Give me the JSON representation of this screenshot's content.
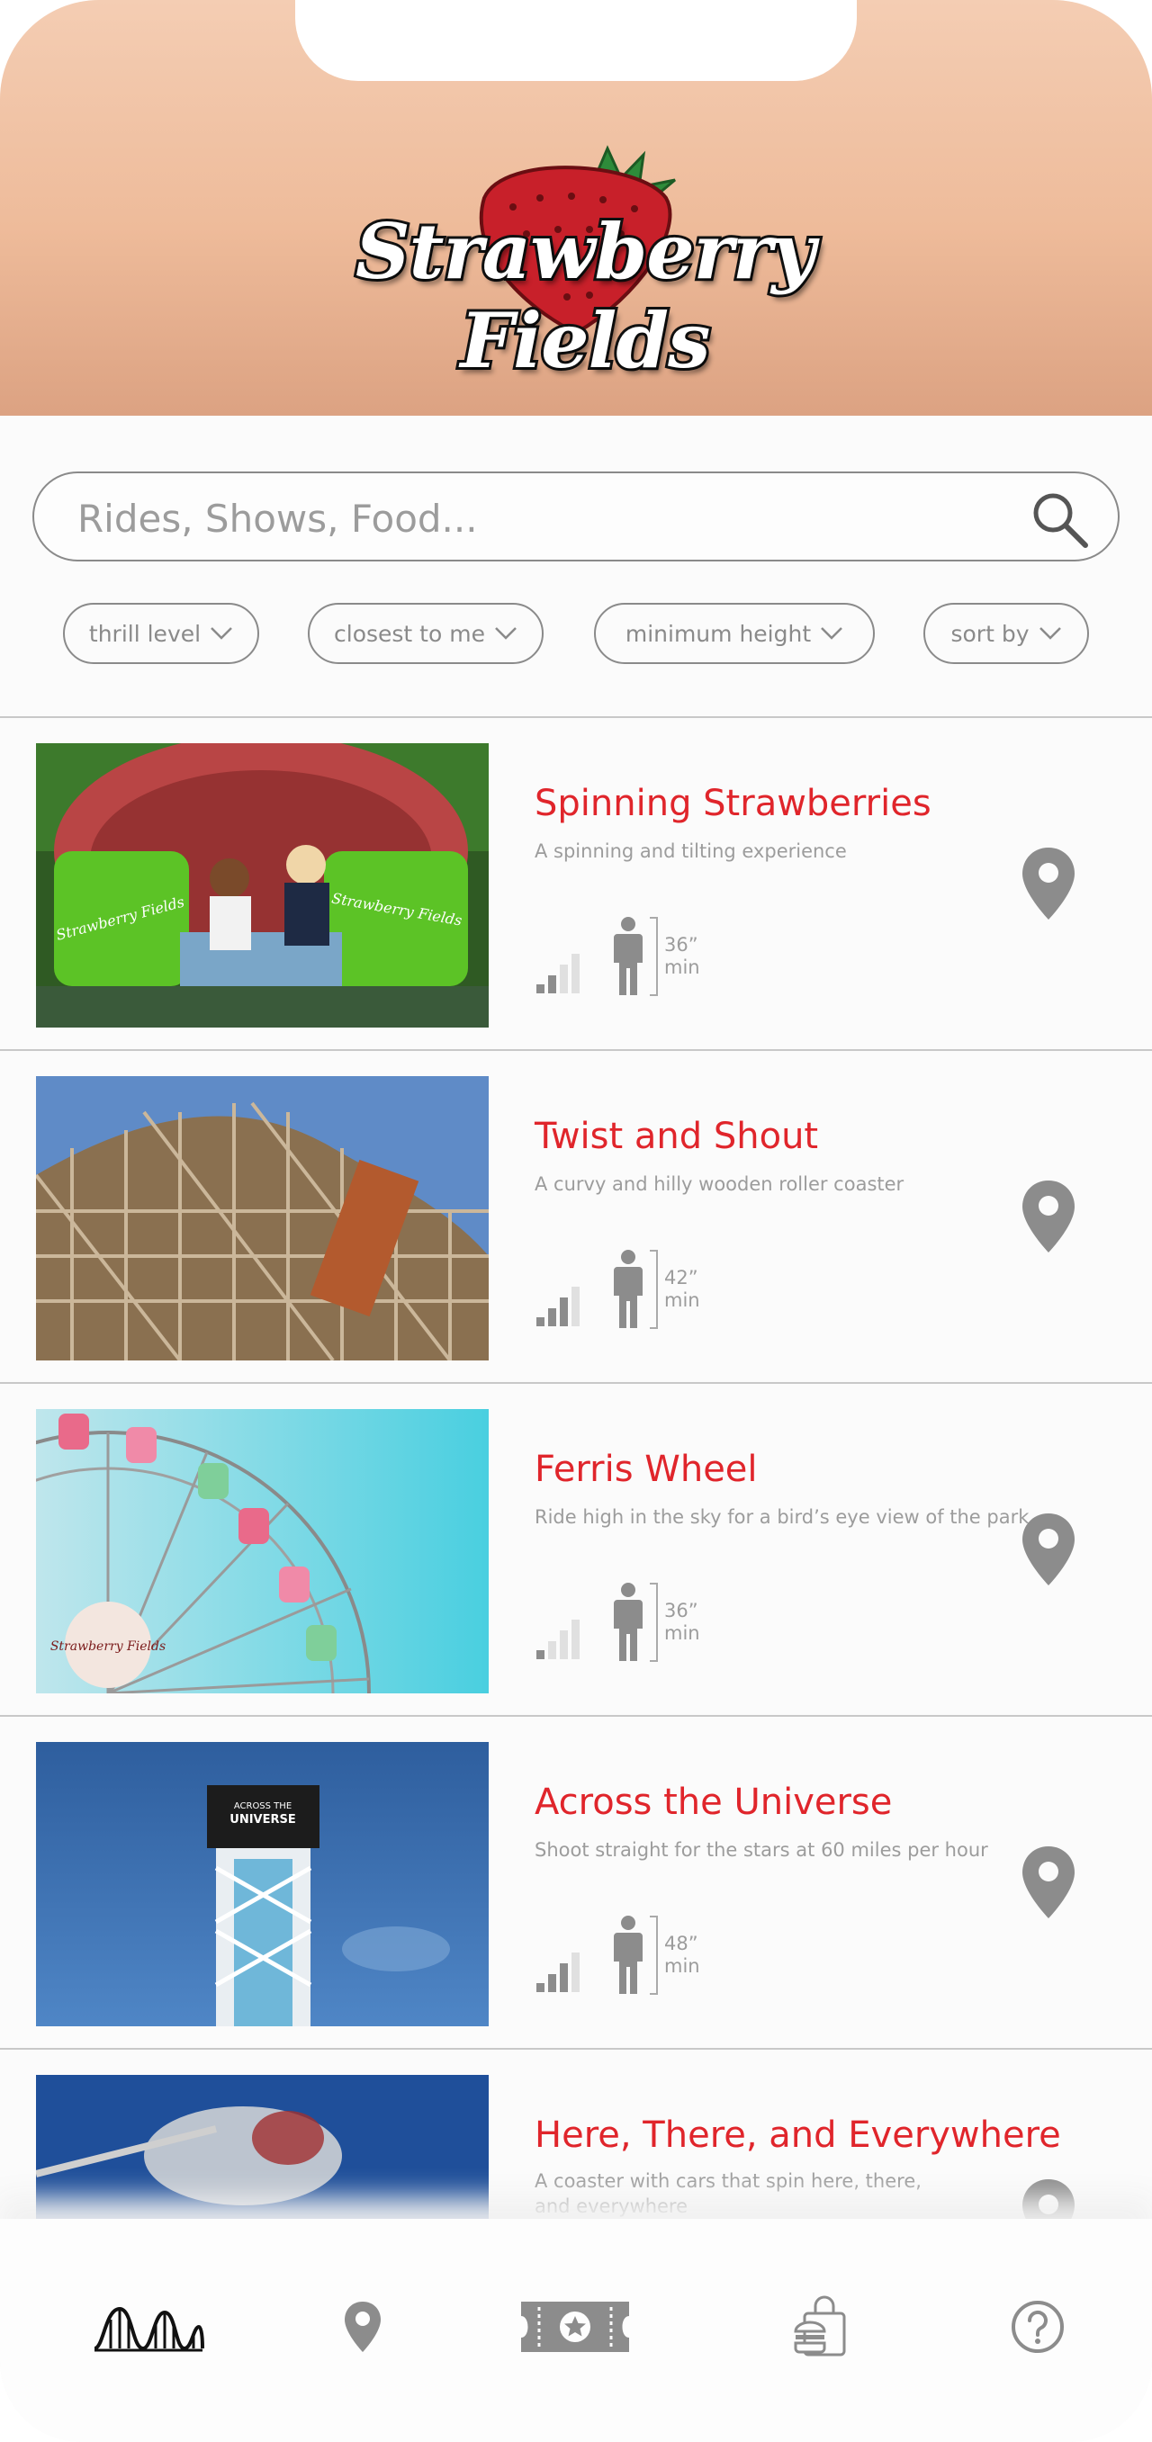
{
  "brand": {
    "logo_text": "Strawberry Fields"
  },
  "search": {
    "placeholder": "Rides, Shows, Food..."
  },
  "filters": [
    {
      "label": "thrill level"
    },
    {
      "label": "closest to me"
    },
    {
      "label": "minimum height"
    },
    {
      "label": "sort by"
    }
  ],
  "rides": [
    {
      "name": "Spinning Strawberries",
      "description": "A spinning and tilting experience",
      "thrill_level": 2,
      "thrill_max": 4,
      "min_height": "36”",
      "min_label": "min"
    },
    {
      "name": "Twist and Shout",
      "description": "A curvy and hilly wooden roller coaster",
      "thrill_level": 3,
      "thrill_max": 4,
      "min_height": "42”",
      "min_label": "min"
    },
    {
      "name": "Ferris Wheel",
      "description": "Ride high in the sky for a bird’s eye view of the park",
      "thrill_level": 1,
      "thrill_max": 4,
      "min_height": "36”",
      "min_label": "min"
    },
    {
      "name": "Across the Universe",
      "description": "Shoot straight for the stars at 60 miles per hour",
      "thrill_level": 3,
      "thrill_max": 4,
      "min_height": "48”",
      "min_label": "min"
    },
    {
      "name": "Here, There, and Everywhere",
      "description": "A coaster with cars that spin here, there, and everywhere"
    }
  ],
  "image_text": {
    "strawberry_tub": "Strawberry Fields",
    "tower_sign_line1": "ACROSS THE",
    "tower_sign_line2": "UNIVERSE"
  },
  "tabs": [
    {
      "icon": "roller-coaster-icon",
      "active": true
    },
    {
      "icon": "map-pin-icon",
      "active": false
    },
    {
      "icon": "ticket-icon",
      "active": false
    },
    {
      "icon": "food-bag-icon",
      "active": false
    },
    {
      "icon": "help-icon",
      "active": false
    }
  ],
  "colors": {
    "accent": "#e0252b",
    "header_top": "#f4cdb3",
    "header_bottom": "#dca282",
    "icon_gray": "#8c8c8c"
  }
}
